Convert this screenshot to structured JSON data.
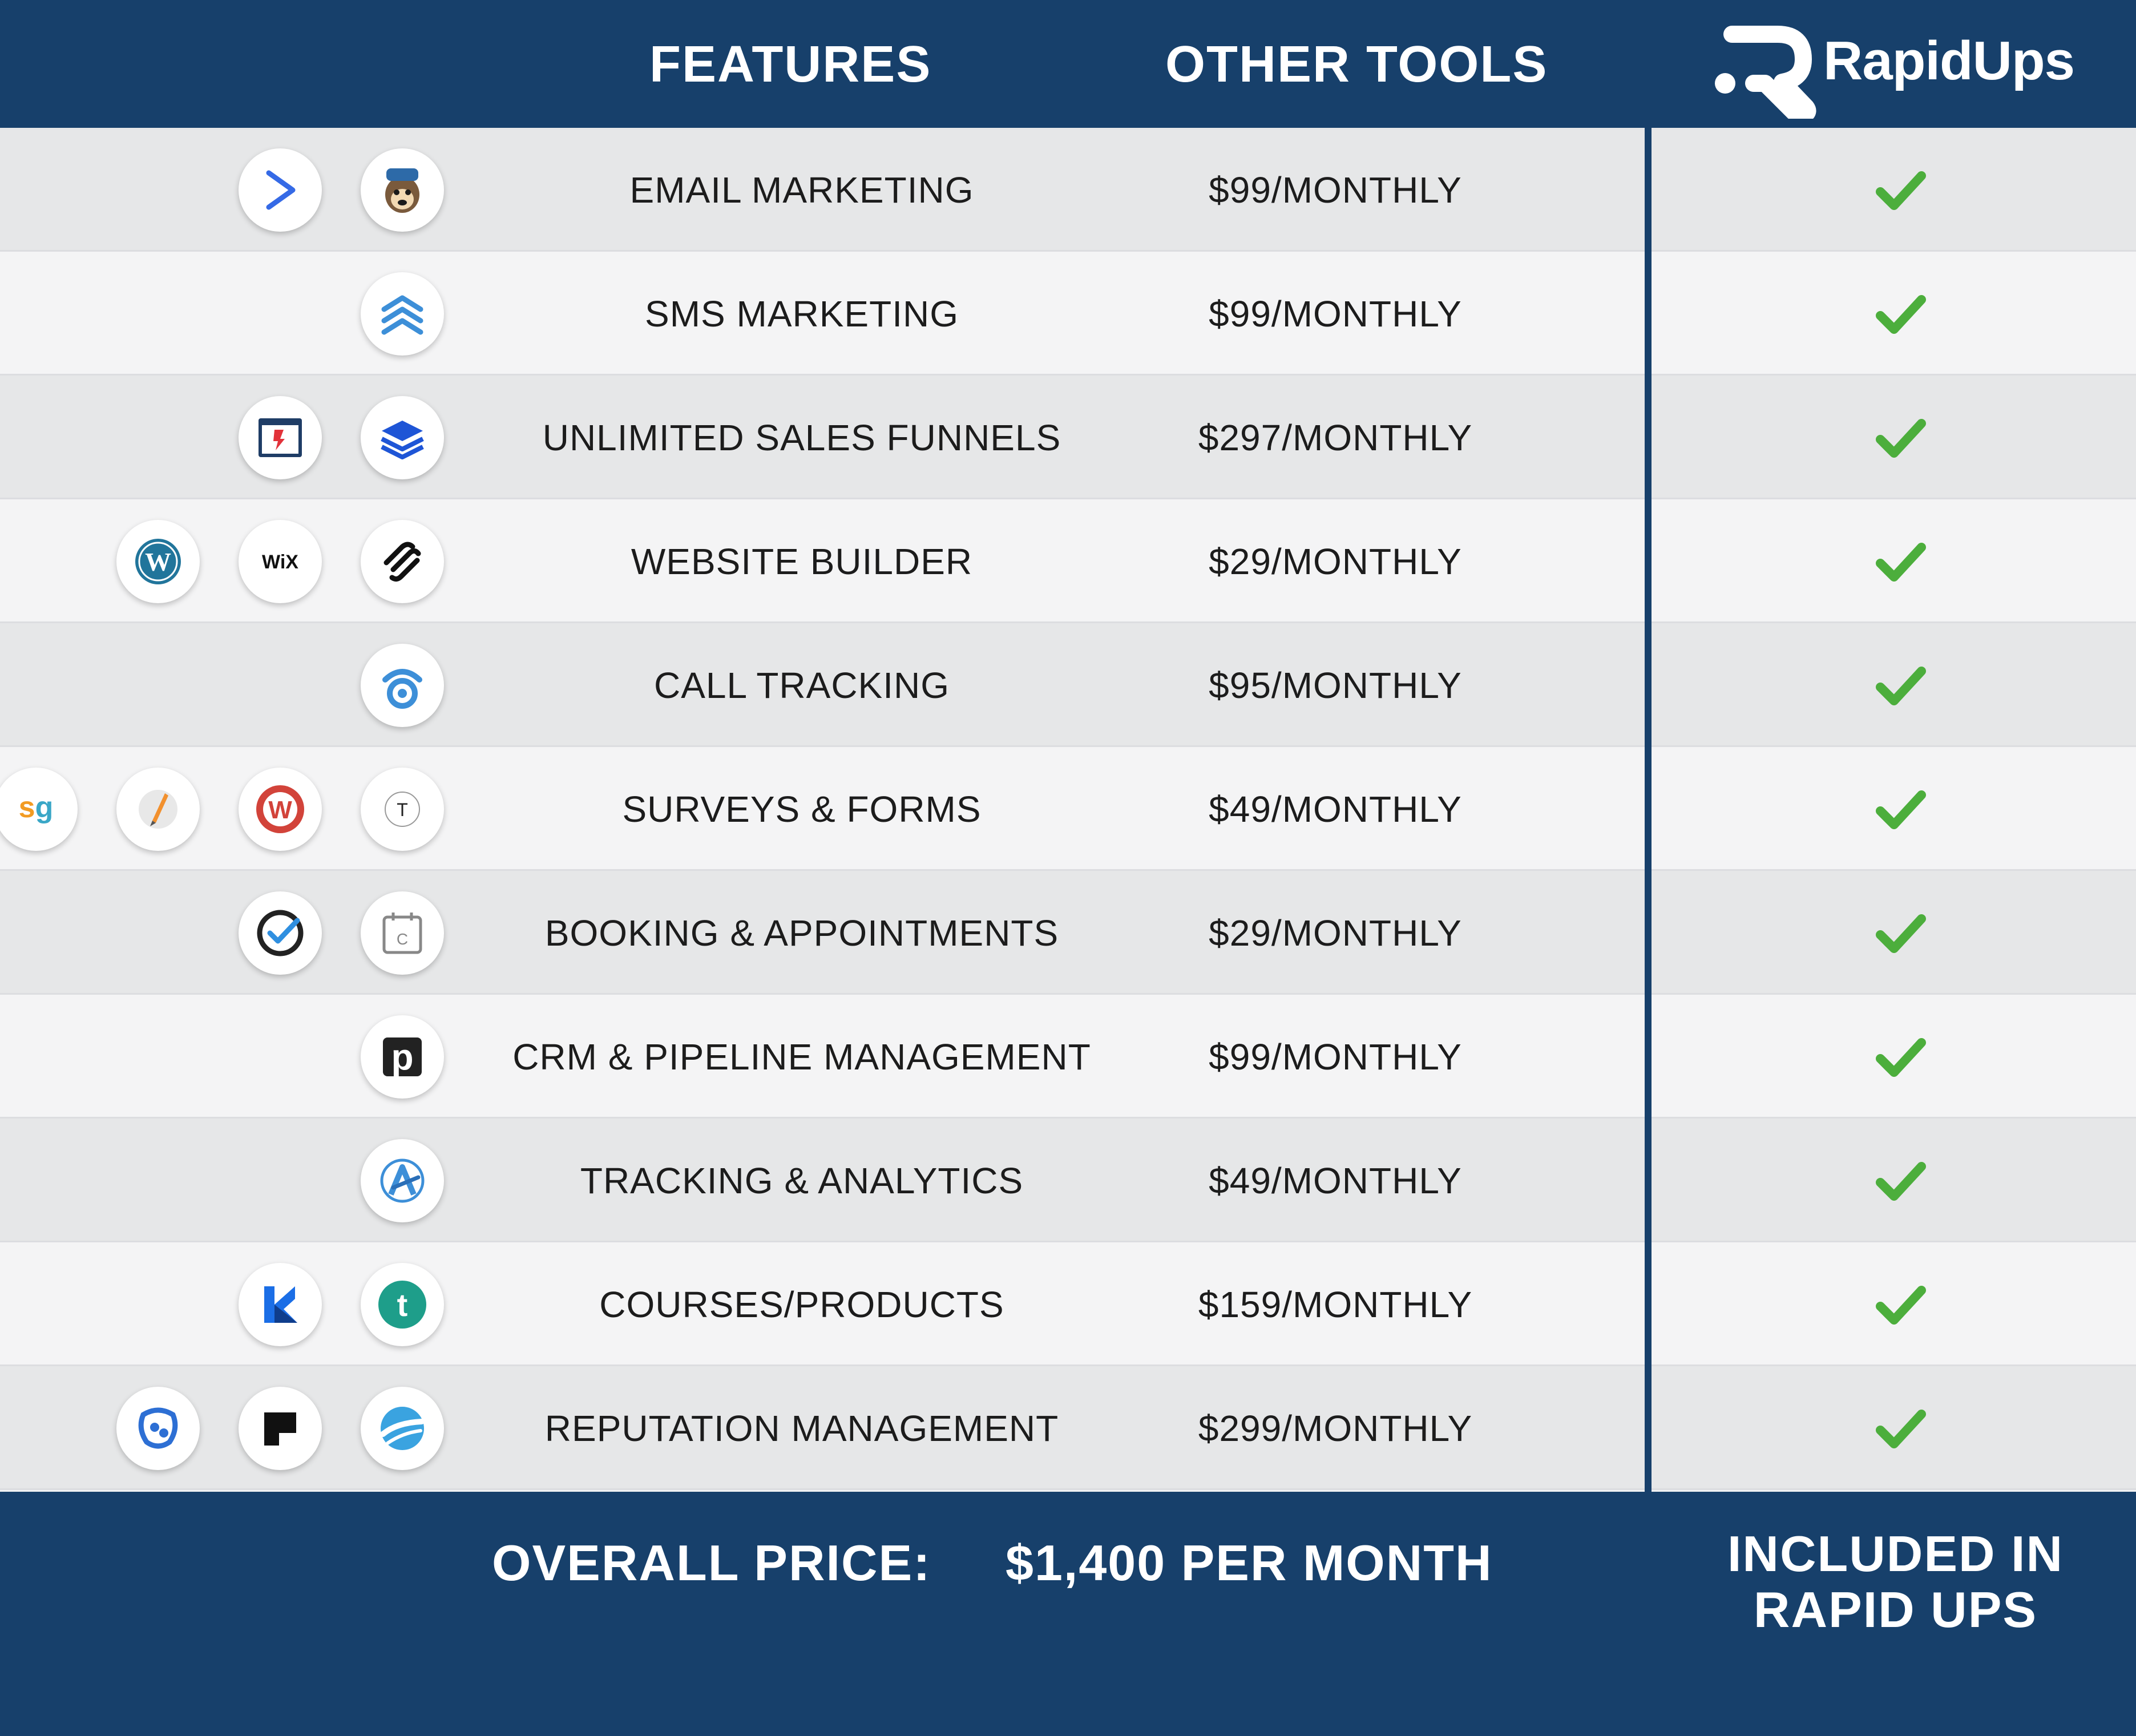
{
  "header": {
    "features_label": "FEATURES",
    "other_tools_label": "OTHER TOOLS",
    "brand_name": "RapidUps"
  },
  "colors": {
    "navy": "#17406b",
    "check_green": "#4cae3c"
  },
  "rows": [
    {
      "feature": "EMAIL MARKETING",
      "price": "$99/MONTHLY",
      "icons": [
        "activecampaign-icon",
        "mailchimp-icon"
      ]
    },
    {
      "feature": "SMS MARKETING",
      "price": "$99/MONTHLY",
      "icons": [
        "sms-chevrons-icon"
      ]
    },
    {
      "feature": "UNLIMITED SALES FUNNELS",
      "price": "$297/MONTHLY",
      "icons": [
        "clickfunnels-icon",
        "layers-icon"
      ]
    },
    {
      "feature": "WEBSITE BUILDER",
      "price": "$29/MONTHLY",
      "icons": [
        "wordpress-icon",
        "wix-icon",
        "squarespace-icon"
      ]
    },
    {
      "feature": "CALL TRACKING",
      "price": "$95/MONTHLY",
      "icons": [
        "call-tracking-icon"
      ]
    },
    {
      "feature": "SURVEYS & FORMS",
      "price": "$49/MONTHLY",
      "icons": [
        "surveygizmo-icon",
        "pen-icon",
        "wufoo-icon",
        "typeform-icon"
      ]
    },
    {
      "feature": "BOOKING & APPOINTMENTS",
      "price": "$29/MONTHLY",
      "icons": [
        "check-circle-icon",
        "calendar-icon"
      ]
    },
    {
      "feature": "CRM & PIPELINE MANAGEMENT",
      "price": "$99/MONTHLY",
      "icons": [
        "pipedrive-icon"
      ]
    },
    {
      "feature": "TRACKING & ANALYTICS",
      "price": "$49/MONTHLY",
      "icons": [
        "analytics-icon"
      ]
    },
    {
      "feature": "COURSES/PRODUCTS",
      "price": "$159/MONTHLY",
      "icons": [
        "kajabi-icon",
        "teachable-icon"
      ]
    },
    {
      "feature": "REPUTATION MANAGEMENT",
      "price": "$299/MONTHLY",
      "icons": [
        "birdeye-icon",
        "podium-icon",
        "swirl-icon"
      ]
    }
  ],
  "wix_text": "WiX",
  "sg_text": "sg",
  "typeform_letter": "T",
  "calendar_letter": "C",
  "pipedrive_letter": "p",
  "teachable_letter": "t",
  "wufoo_letter": "W",
  "footer": {
    "overall_label": "OVERALL PRICE:",
    "overall_value": "$1,400 PER MONTH",
    "included_line1": "INCLUDED IN",
    "included_line2": "RAPID UPS"
  }
}
